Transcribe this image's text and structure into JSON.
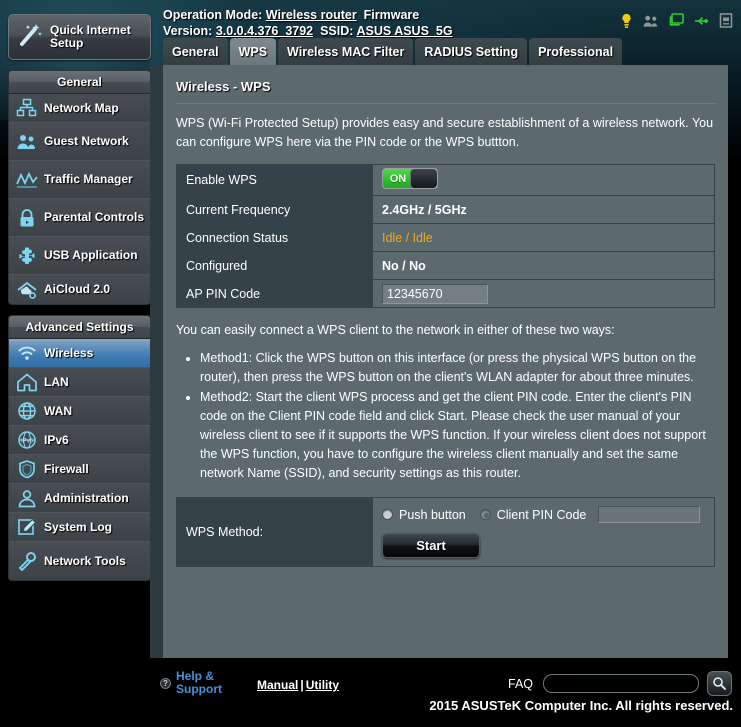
{
  "sidebar": {
    "quick_setup": {
      "label": "Quick Internet Setup",
      "icon": "magic-wand-icon"
    },
    "general_header": "General",
    "general_items": [
      {
        "label": "Network Map",
        "icon": "network-map-icon"
      },
      {
        "label": "Guest Network",
        "icon": "guest-network-icon"
      },
      {
        "label": "Traffic Manager",
        "icon": "traffic-manager-icon"
      },
      {
        "label": "Parental Controls",
        "icon": "lock-icon"
      },
      {
        "label": "USB Application",
        "icon": "usb-puzzle-icon"
      },
      {
        "label": "AiCloud 2.0",
        "icon": "aicloud-icon"
      }
    ],
    "advanced_header": "Advanced Settings",
    "advanced_items": [
      {
        "label": "Wireless",
        "icon": "wifi-icon",
        "active": true
      },
      {
        "label": "LAN",
        "icon": "home-icon",
        "active": false
      },
      {
        "label": "WAN",
        "icon": "globe-icon",
        "active": false
      },
      {
        "label": "IPv6",
        "icon": "ipv6-globe-icon",
        "active": false
      },
      {
        "label": "Firewall",
        "icon": "shield-icon",
        "active": false
      },
      {
        "label": "Administration",
        "icon": "user-icon",
        "active": false
      },
      {
        "label": "System Log",
        "icon": "pencil-note-icon",
        "active": false
      },
      {
        "label": "Network Tools",
        "icon": "wrench-icon",
        "active": false
      }
    ]
  },
  "header": {
    "operation_mode_label": "Operation Mode:",
    "operation_mode_value": "Wireless router",
    "firmware_label": "Firmware Version:",
    "firmware_value": "3.0.0.4.376_3792",
    "ssid_label": "SSID:",
    "ssid_value": "ASUS ASUS_5G",
    "status_icons": [
      {
        "name": "alert-bulb-icon",
        "color": "#f2c811"
      },
      {
        "name": "guest-users-icon",
        "color": "#8f9698"
      },
      {
        "name": "clients-monitor-icon",
        "color": "#2fd02f"
      },
      {
        "name": "usb-icon",
        "color": "#2fd02f"
      },
      {
        "name": "printer-log-icon",
        "color": "#8f9698"
      }
    ]
  },
  "tabs": [
    {
      "label": "General",
      "active": false
    },
    {
      "label": "WPS",
      "active": true
    },
    {
      "label": "Wireless MAC Filter",
      "active": false
    },
    {
      "label": "RADIUS Setting",
      "active": false
    },
    {
      "label": "Professional",
      "active": false
    }
  ],
  "panel": {
    "title": "Wireless - WPS",
    "description": "WPS (Wi-Fi Protected Setup) provides easy and secure establishment of a wireless network. You can configure WPS here via the PIN code or the WPS buttton.",
    "settings": [
      {
        "label": "Enable WPS",
        "type": "toggle",
        "value": "ON"
      },
      {
        "label": "Current Frequency",
        "type": "text",
        "value": "2.4GHz / 5GHz"
      },
      {
        "label": "Connection Status",
        "type": "status",
        "value": "Idle / Idle"
      },
      {
        "label": "Configured",
        "type": "text",
        "value": "No / No"
      },
      {
        "label": "AP PIN Code",
        "type": "input",
        "value": "12345670"
      }
    ],
    "howto_intro": "You can easily connect a WPS client to the network in either of these two ways:",
    "methods": [
      "Method1: Click the WPS button on this interface (or press the physical WPS button on the router), then press the WPS button on the client's WLAN adapter for about three minutes.",
      "Method2: Start the client WPS process and get the client PIN code. Enter the client's PIN code on the Client PIN code field and click Start. Please check the user manual of your wireless client to see if it supports the WPS function. If your wireless client does not support the WPS function, you have to configure the wireless client manually and set the same network Name (SSID), and security settings as this router."
    ],
    "wps_method": {
      "label": "WPS Method:",
      "push_button_label": "Push button",
      "push_button_selected": true,
      "client_pin_label": "Client PIN Code",
      "client_pin_selected": false,
      "client_pin_value": "",
      "start_label": "Start"
    }
  },
  "footer": {
    "help_line1": "Help &",
    "help_line2": "Support",
    "manual_label": "Manual",
    "separator": "|",
    "utility_label": "Utility",
    "faq_label": "FAQ",
    "search_value": "",
    "copyright": "2015 ASUSTeK Computer Inc. All rights reserved."
  },
  "colors": {
    "panel_bg": "#5c6a6e",
    "label_cell_bg": "#36424a",
    "accent_blue": "#3f7cb3",
    "status_amber": "#f0a818",
    "toggle_green": "#2cc02c"
  }
}
